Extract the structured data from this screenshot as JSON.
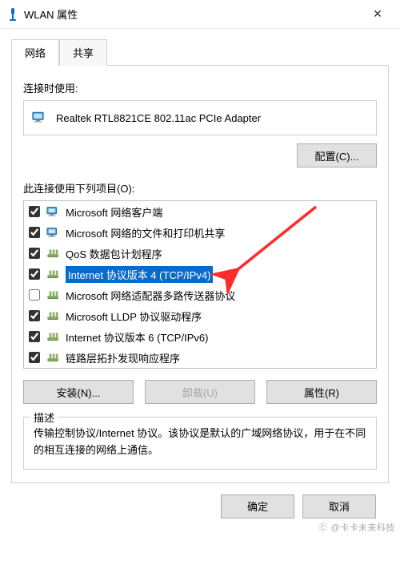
{
  "window": {
    "title": "WLAN 属性",
    "close_x": "✕"
  },
  "tabs": {
    "network": "网络",
    "share": "共享",
    "active": "network"
  },
  "connect_using_label": "连接时使用:",
  "adapter_name": "Realtek RTL8821CE 802.11ac PCIe Adapter",
  "configure_btn": "配置(C)...",
  "items_list_label": "此连接使用下列项目(O):",
  "items": [
    {
      "checked": true,
      "icon": "client",
      "label": "Microsoft 网络客户端",
      "selected": false
    },
    {
      "checked": true,
      "icon": "client",
      "label": "Microsoft 网络的文件和打印机共享",
      "selected": false
    },
    {
      "checked": true,
      "icon": "proto",
      "label": "QoS 数据包计划程序",
      "selected": false
    },
    {
      "checked": true,
      "icon": "proto",
      "label": "Internet 协议版本 4 (TCP/IPv4)",
      "selected": true
    },
    {
      "checked": false,
      "icon": "proto",
      "label": "Microsoft 网络适配器多路传送器协议",
      "selected": false
    },
    {
      "checked": true,
      "icon": "proto",
      "label": "Microsoft LLDP 协议驱动程序",
      "selected": false
    },
    {
      "checked": true,
      "icon": "proto",
      "label": "Internet 协议版本 6 (TCP/IPv6)",
      "selected": false
    },
    {
      "checked": true,
      "icon": "proto",
      "label": "链路层拓扑发现响应程序",
      "selected": false
    }
  ],
  "install_btn": "安装(N)...",
  "uninstall_btn": "卸载(U)",
  "properties_btn": "属性(R)",
  "description": {
    "legend": "描述",
    "text": "传输控制协议/Internet 协议。该协议是默认的广域网络协议，用于在不同的相互连接的网络上通信。"
  },
  "footer": {
    "ok": "确定",
    "cancel": "取消"
  },
  "watermark": "Ⓒ @卡卡未来科技",
  "colors": {
    "selection": "#0a6acb",
    "arrow": "#ff2a2a"
  }
}
